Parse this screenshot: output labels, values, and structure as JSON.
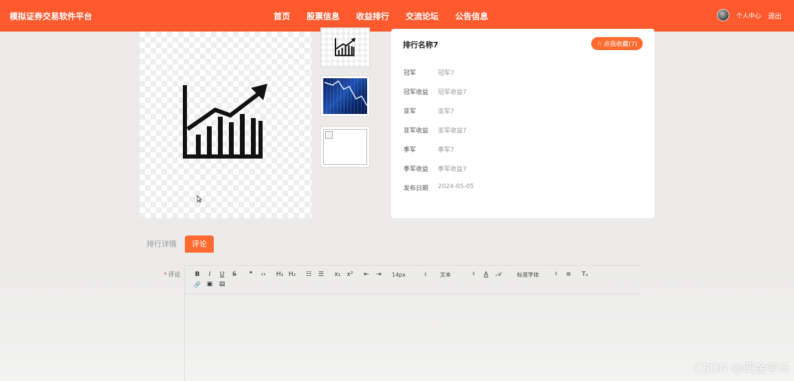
{
  "header": {
    "brand": "模拟证券交易软件平台",
    "nav": [
      "首页",
      "股票信息",
      "收益排行",
      "交流论坛",
      "公告信息"
    ],
    "user_center": "个人中心",
    "logout": "退出"
  },
  "detail": {
    "title": "排行名称7",
    "favorite_label": "点我收藏(7)",
    "rows": [
      {
        "k": "冠军",
        "v": "冠军7"
      },
      {
        "k": "冠军收益",
        "v": "冠军收益7"
      },
      {
        "k": "亚军",
        "v": "亚军7"
      },
      {
        "k": "亚军收益",
        "v": "亚军收益7"
      },
      {
        "k": "季军",
        "v": "季军7"
      },
      {
        "k": "季军收益",
        "v": "季军收益7"
      },
      {
        "k": "发布日期",
        "v": "2024-05-05"
      }
    ]
  },
  "tabs": {
    "detail": "排行详情",
    "comment": "评论"
  },
  "comment": {
    "required_mark": "*",
    "label": "评论",
    "toolbar": {
      "bold": "B",
      "italic": "I",
      "underline": "U",
      "strike": "S",
      "quote": "❞",
      "code": "‹›",
      "h1": "H₁",
      "h2": "H₂",
      "ol": "☷",
      "ul": "☰",
      "sub": "x₁",
      "sup": "x²",
      "outdent": "⇤",
      "indent": "⇥",
      "size": "14px",
      "format": "文本",
      "color": "A",
      "bg": "𝒜",
      "font": "标准字体",
      "align": "≡",
      "clean": "Tₓ",
      "link": "🔗",
      "image": "▣",
      "video": "▤"
    }
  },
  "watermark": "CSDN @四金学长",
  "colors": {
    "primary": "#ff5a2e",
    "accent": "#ff6a2e"
  }
}
